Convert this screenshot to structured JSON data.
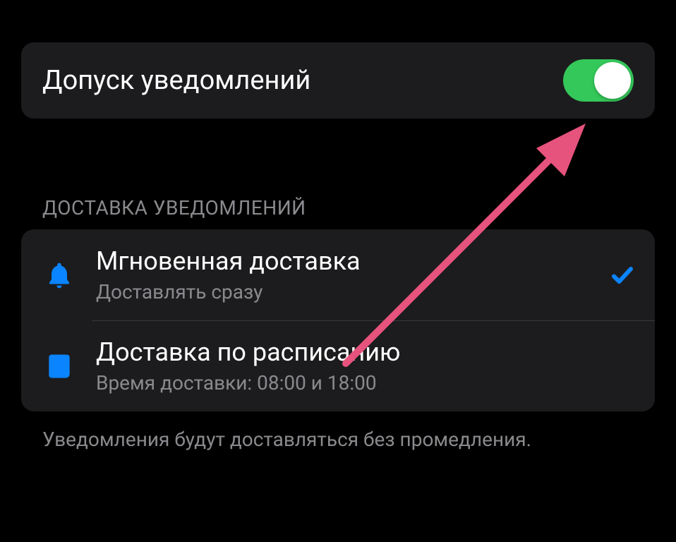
{
  "allow": {
    "label": "Допуск уведомлений",
    "enabled": true
  },
  "delivery": {
    "section_label": "ДОСТАВКА УВЕДОМЛЕНИЙ",
    "options": [
      {
        "title": "Мгновенная доставка",
        "subtitle": "Доставлять сразу",
        "icon": "bell-icon",
        "selected": true
      },
      {
        "title": "Доставка по расписанию",
        "subtitle": "Время доставки: 08:00 и 18:00",
        "icon": "newspaper-icon",
        "selected": false
      }
    ],
    "footer": "Уведомления будут доставляться без промедления."
  },
  "colors": {
    "accent_blue": "#0a84ff",
    "switch_green": "#34c759",
    "card_bg": "#1c1c1e",
    "muted_text": "#8a8a8e",
    "annotation_arrow": "#e6537d"
  }
}
